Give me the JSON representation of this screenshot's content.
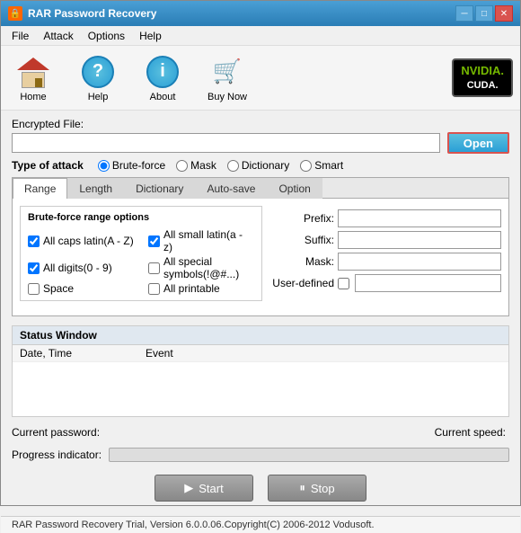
{
  "window": {
    "title": "RAR Password Recovery",
    "title_icon": "🔒"
  },
  "menu": {
    "items": [
      "File",
      "Attack",
      "Options",
      "Help"
    ]
  },
  "toolbar": {
    "home_label": "Home",
    "help_label": "Help",
    "about_label": "About",
    "buynow_label": "Buy Now",
    "nvidia_line1": "NVIDIA.",
    "nvidia_line2": "CUDA."
  },
  "encrypted_file": {
    "label": "Encrypted File:",
    "value": "",
    "open_button": "Open"
  },
  "attack": {
    "label": "Type of attack",
    "options": [
      "Brute-force",
      "Mask",
      "Dictionary",
      "Smart"
    ],
    "selected": "Brute-force"
  },
  "tabs": {
    "items": [
      "Range",
      "Length",
      "Dictionary",
      "Auto-save",
      "Option"
    ],
    "active": "Range"
  },
  "brute_force": {
    "section_label": "Brute-force range options",
    "checkboxes": [
      {
        "label": "All caps latin(A - Z)",
        "checked": true
      },
      {
        "label": "All small latin(a - z)",
        "checked": true
      },
      {
        "label": "All digits(0 - 9)",
        "checked": true
      },
      {
        "label": "All special symbols(!@#...)",
        "checked": false
      },
      {
        "label": "Space",
        "checked": false
      },
      {
        "label": "All printable",
        "checked": false
      }
    ],
    "prefix_label": "Prefix:",
    "suffix_label": "Suffix:",
    "mask_label": "Mask:",
    "user_defined_label": "User-defined"
  },
  "status": {
    "section_label": "Status Window",
    "col_date": "Date, Time",
    "col_event": "Event"
  },
  "bottom": {
    "current_password_label": "Current password:",
    "current_password_value": "",
    "current_speed_label": "Current speed:",
    "current_speed_value": "",
    "progress_label": "Progress indicator:"
  },
  "buttons": {
    "start": "Start",
    "stop": "Stop",
    "start_icon": "▶",
    "stop_icon": "⏸"
  },
  "footer": "RAR Password Recovery Trial, Version 6.0.0.06.Copyright(C) 2006-2012 Vodusoft."
}
